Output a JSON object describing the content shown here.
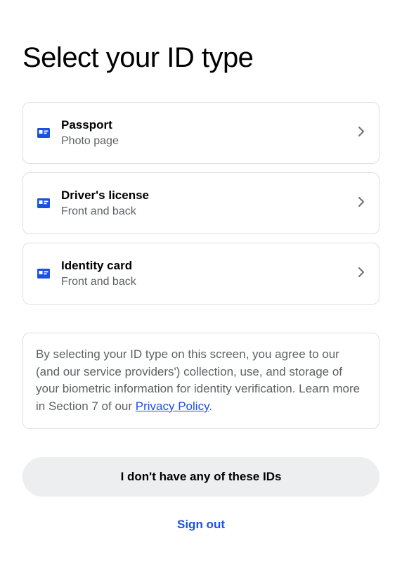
{
  "title": "Select your ID type",
  "options": [
    {
      "title": "Passport",
      "subtitle": "Photo page"
    },
    {
      "title": "Driver's license",
      "subtitle": "Front and back"
    },
    {
      "title": "Identity card",
      "subtitle": "Front and back"
    }
  ],
  "disclosure": {
    "text_before_link": "By selecting your ID type on this screen, you agree to our (and our service providers') collection, use, and storage of your biometric information for identity verification. Learn more in Section 7 of our ",
    "link_text": "Privacy Policy",
    "text_after_link": "."
  },
  "no_id_button_label": "I don't have any of these IDs",
  "sign_out_label": "Sign out"
}
